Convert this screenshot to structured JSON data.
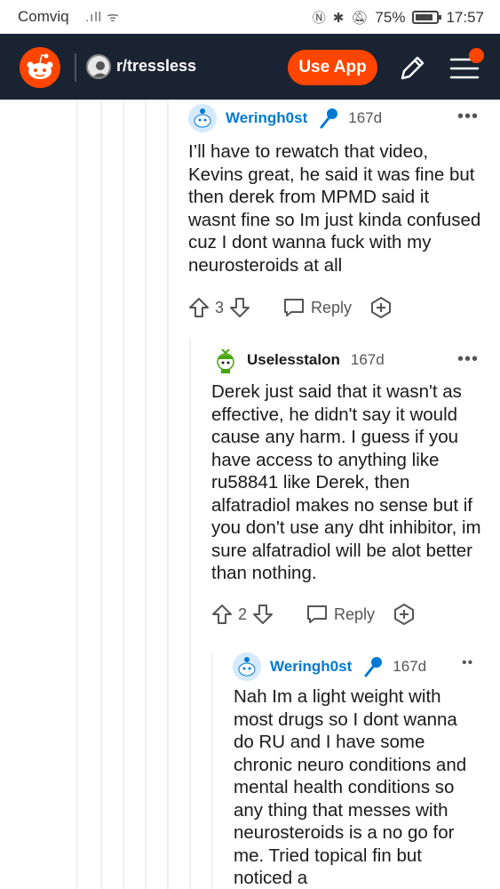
{
  "status_bar": {
    "carrier": "Comviq",
    "battery": "75%",
    "time": "17:57"
  },
  "header": {
    "subreddit": "r/tressless",
    "use_app_label": "Use App"
  },
  "comments": [
    {
      "username": "Weringh0st",
      "age": "167d",
      "text": "I’ll have to rewatch that video, Kevins great, he said it was fine but then derek from MPMD said it wasnt fine so Im just kinda confused cuz I dont wanna fuck with my neurosteroids at all",
      "score": "3",
      "reply_label": "Reply"
    },
    {
      "username": "Uselesstalon",
      "age": "167d",
      "text": "Derek just said that it wasn't as effective, he didn't say it would cause any harm. I guess if you have access to anything like ru58841 like Derek, then alfatradiol makes no sense but if you don't use any dht inhibitor, im sure alfatradiol will be alot better than nothing.",
      "score": "2",
      "reply_label": "Reply"
    },
    {
      "username": "Weringh0st",
      "age": "167d",
      "text": "Nah Im a light weight with most drugs so I dont wanna do RU and I have some chronic neuro conditions and mental health conditions so any thing that messes with neurosteroids is a no go for me. Tried topical fin but noticed a"
    }
  ],
  "colors": {
    "header_bg": "#1a2332",
    "brand": "#ff4500",
    "username": "#0079d3"
  }
}
